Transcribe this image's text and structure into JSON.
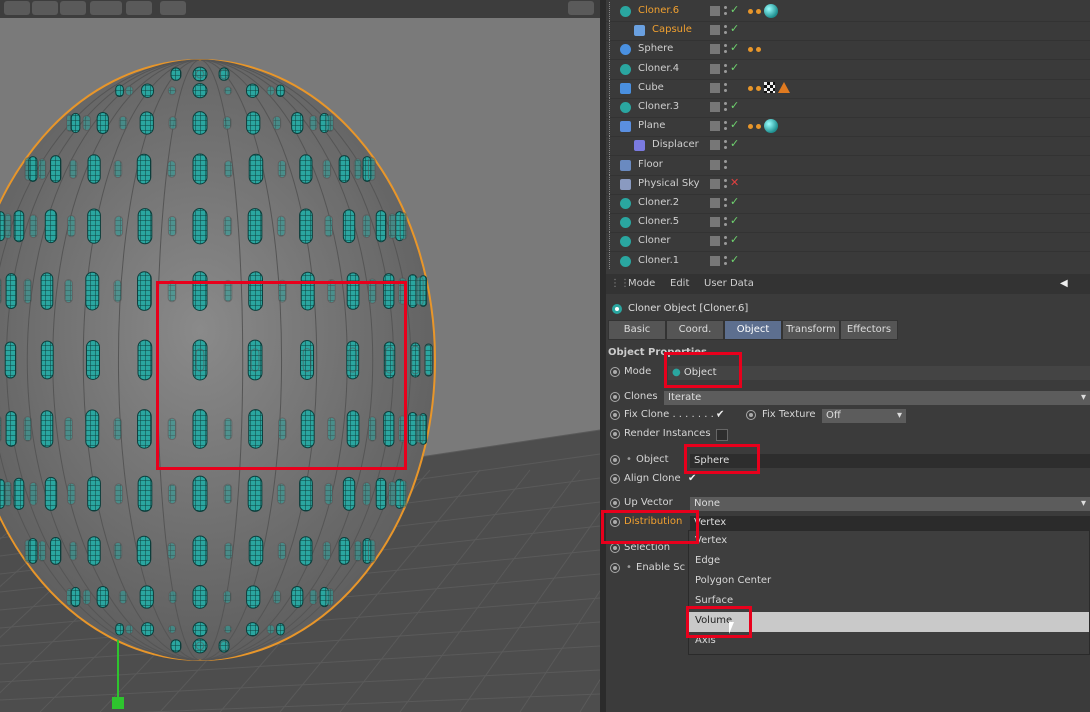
{
  "object_manager": {
    "items": [
      {
        "name": "Cloner.6",
        "icon": "cloner-icon",
        "depth": 0,
        "status": "check",
        "selected": true
      },
      {
        "name": "Capsule",
        "icon": "capsule-icon",
        "depth": 1,
        "status": "check",
        "selected": true
      },
      {
        "name": "Sphere",
        "icon": "sphere-icon",
        "depth": 0,
        "status": "check",
        "selected": false
      },
      {
        "name": "Cloner.4",
        "icon": "cloner-icon",
        "depth": 0,
        "status": "check",
        "selected": false
      },
      {
        "name": "Cube",
        "icon": "cube-icon",
        "depth": 0,
        "status": "none",
        "selected": false
      },
      {
        "name": "Cloner.3",
        "icon": "cloner-icon",
        "depth": 0,
        "status": "check",
        "selected": false
      },
      {
        "name": "Plane",
        "icon": "plane-icon",
        "depth": 0,
        "status": "check",
        "selected": false
      },
      {
        "name": "Displacer",
        "icon": "displacer-icon",
        "depth": 1,
        "status": "check",
        "selected": false
      },
      {
        "name": "Floor",
        "icon": "floor-icon",
        "depth": 0,
        "status": "none",
        "selected": false
      },
      {
        "name": "Physical Sky",
        "icon": "sky-icon",
        "depth": 0,
        "status": "x",
        "selected": false
      },
      {
        "name": "Cloner.2",
        "icon": "cloner-icon",
        "depth": 0,
        "status": "check",
        "selected": false
      },
      {
        "name": "Cloner.5",
        "icon": "cloner-icon",
        "depth": 0,
        "status": "check",
        "selected": false
      },
      {
        "name": "Cloner",
        "icon": "cloner-icon",
        "depth": 0,
        "status": "check",
        "selected": false
      },
      {
        "name": "Cloner.1",
        "icon": "cloner-icon",
        "depth": 0,
        "status": "check",
        "selected": false
      }
    ]
  },
  "attributes": {
    "menu": {
      "mode": "Mode",
      "edit": "Edit",
      "user_data": "User Data"
    },
    "title": "Cloner Object [Cloner.6]",
    "tabs": [
      "Basic",
      "Coord.",
      "Object",
      "Transform",
      "Effectors"
    ],
    "active_tab": "Object",
    "section": "Object Properties",
    "mode_label": "Mode",
    "mode_value": "Object",
    "clones_label": "Clones",
    "clones_value": "Iterate",
    "fix_clone_label": "Fix Clone . . . . . . . .",
    "fix_clone_check": "✔",
    "fix_texture_label": "Fix Texture",
    "fix_texture_value": "Off",
    "render_instances_label": "Render Instances",
    "object_label": "Object",
    "object_value": "Sphere",
    "align_clone_label": "Align Clone",
    "align_clone_check": "✔",
    "up_vector_label": "Up Vector",
    "up_vector_value": "None",
    "distribution_label": "Distribution",
    "distribution_value": "Vertex",
    "selection_label": "Selection",
    "enable_scale_label": "Enable Sc"
  },
  "distribution_options": [
    "Vertex",
    "Edge",
    "Polygon Center",
    "Surface",
    "Volume",
    "Axis"
  ],
  "hovered_option": "Volume",
  "colors": {
    "accent_selected": "#f0a030",
    "highlight_box": "#e8001c",
    "clone_teal": "#2aa6a0"
  }
}
